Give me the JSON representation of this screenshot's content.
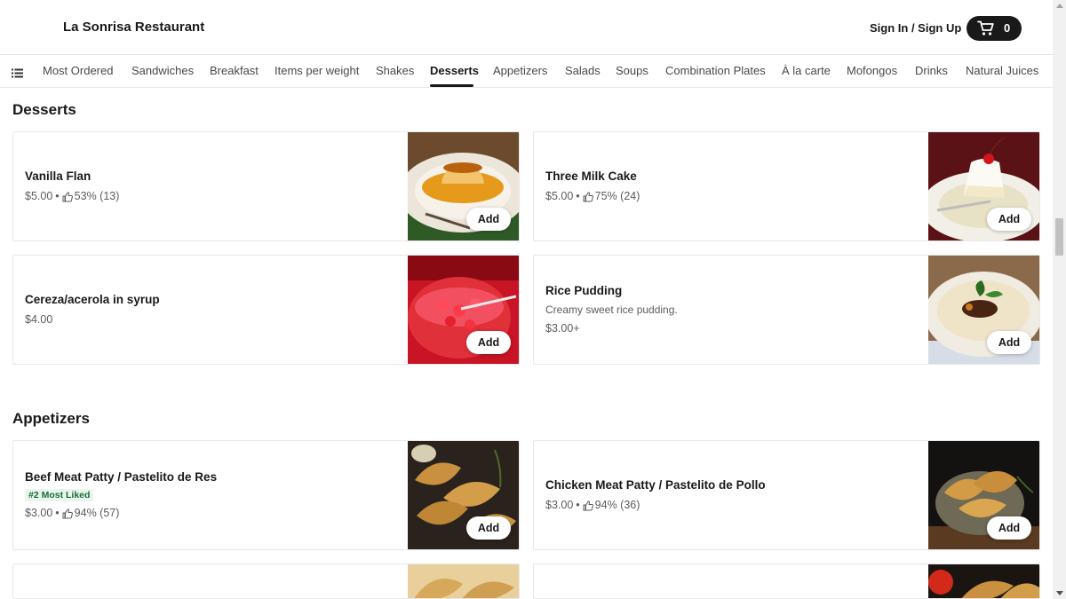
{
  "header": {
    "restaurant_name": "La Sonrisa Restaurant",
    "signin_label": "Sign In / Sign Up",
    "cart_count": "0"
  },
  "nav": {
    "tabs": [
      {
        "label": "Most Ordered"
      },
      {
        "label": "Sandwiches"
      },
      {
        "label": "Breakfast"
      },
      {
        "label": "Items per weight"
      },
      {
        "label": "Shakes"
      },
      {
        "label": "Desserts",
        "active": true
      },
      {
        "label": "Appetizers"
      },
      {
        "label": "Salads"
      },
      {
        "label": "Soups"
      },
      {
        "label": "Combination Plates"
      },
      {
        "label": "À la carte"
      },
      {
        "label": "Mofongos"
      },
      {
        "label": "Drinks"
      },
      {
        "label": "Natural Juices"
      }
    ]
  },
  "sections": [
    {
      "title": "Desserts",
      "items": [
        {
          "name": "Vanilla Flan",
          "price": "$5.00",
          "rating": "53% (13)",
          "add_label": "Add"
        },
        {
          "name": "Three Milk Cake",
          "price": "$5.00",
          "rating": "75% (24)",
          "add_label": "Add"
        },
        {
          "name": "Cereza/acerola in syrup",
          "price": "$4.00",
          "add_label": "Add"
        },
        {
          "name": "Rice Pudding",
          "description": "Creamy sweet rice pudding.",
          "price": "$3.00+",
          "add_label": "Add"
        }
      ]
    },
    {
      "title": "Appetizers",
      "items": [
        {
          "name": "Beef Meat Patty / Pastelito de Res",
          "badge": "#2 Most Liked",
          "price": "$3.00",
          "rating": "94% (57)",
          "add_label": "Add"
        },
        {
          "name": "Chicken Meat Patty / Pastelito de Pollo",
          "price": "$3.00",
          "rating": "94% (36)",
          "add_label": "Add"
        }
      ]
    }
  ],
  "icons": {
    "cart": "cart-icon",
    "menu": "list-menu-icon",
    "thumbs_up": "thumbs-up-icon"
  },
  "colors": {
    "primary": "#191919",
    "badge_text": "#1b6b3a",
    "badge_bg": "#e8f6ec"
  }
}
